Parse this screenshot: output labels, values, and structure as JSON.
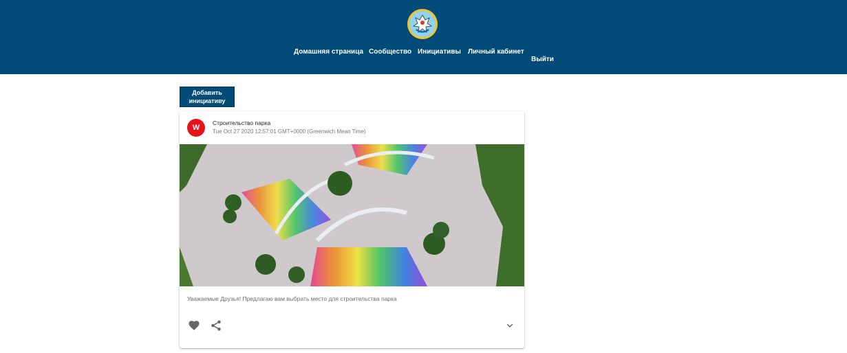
{
  "header": {
    "emblem_icon": "coat-of-arms-icon",
    "background_color": "#004b78",
    "nav": {
      "home": "Домашняя страница",
      "community": "Сообщество",
      "initiatives": "Инициативы",
      "cabinet": "Личный кабинет",
      "logout": "Выйти"
    }
  },
  "actions": {
    "add_initiative": "Добавить инициативу"
  },
  "post": {
    "avatar_letter": "W",
    "avatar_color": "#e8121a",
    "title": "Строительство парка",
    "date": "Tue Oct 27 2020 12:57:01 GMT+0000 (Greenwich Mean Time)",
    "image_icon": "park-rendering-image",
    "description": "Уважаемые Друзья! Предлагаю вам выбрать место для строительства парка",
    "like_icon": "heart-icon",
    "share_icon": "share-icon",
    "expand_icon": "chevron-down-icon"
  }
}
